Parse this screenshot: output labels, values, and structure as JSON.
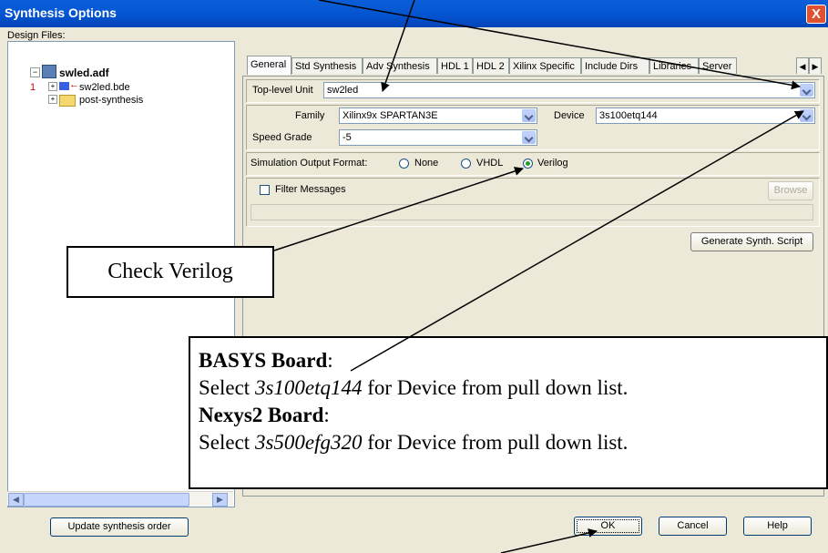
{
  "window": {
    "title": "Synthesis Options",
    "close_glyph": "X"
  },
  "design_files": {
    "label": "Design Files:",
    "root": "swled.adf",
    "items": [
      {
        "marker": "1",
        "label": "sw2led.bde"
      },
      {
        "marker": "",
        "label": "post-synthesis"
      }
    ],
    "update_button": "Update synthesis order"
  },
  "tabs": [
    "General",
    "Std Synthesis",
    "Adv Synthesis",
    "HDL 1",
    "HDL 2",
    "Xilinx Specific",
    "Include Dirs",
    "Libraries",
    "Server"
  ],
  "general": {
    "top_level_label": "Top-level Unit",
    "top_level_value": "sw2led",
    "family_label": "Family",
    "family_value": "Xilinx9x SPARTAN3E",
    "device_label": "Device",
    "device_value": "3s100etq144",
    "speed_label": "Speed Grade",
    "speed_value": "-5",
    "sim_label": "Simulation Output Format:",
    "sim_options": [
      "None",
      "VHDL",
      "Verilog"
    ],
    "sim_selected": "Verilog",
    "filter_label": "Filter Messages",
    "browse_label": "Browse",
    "generate_label": "Generate Synth. Script"
  },
  "footer": {
    "ok": "OK",
    "cancel": "Cancel",
    "help": "Help"
  },
  "annotations": {
    "check_verilog": "Check Verilog",
    "basys_title": "BASYS Board",
    "basys_prefix": "Select ",
    "basys_device": "3s100etq144",
    "basys_suffix": " for Device from pull down list.",
    "nexys_title": "Nexys2 Board",
    "nexys_prefix": "Select ",
    "nexys_device": "3s500efg320",
    "nexys_suffix": " for Device from pull down list."
  },
  "colors": {
    "titlebar": "#0454d0",
    "face": "#ece9d8",
    "selected_radio": "#21a121",
    "red_marker": "#d40000"
  }
}
